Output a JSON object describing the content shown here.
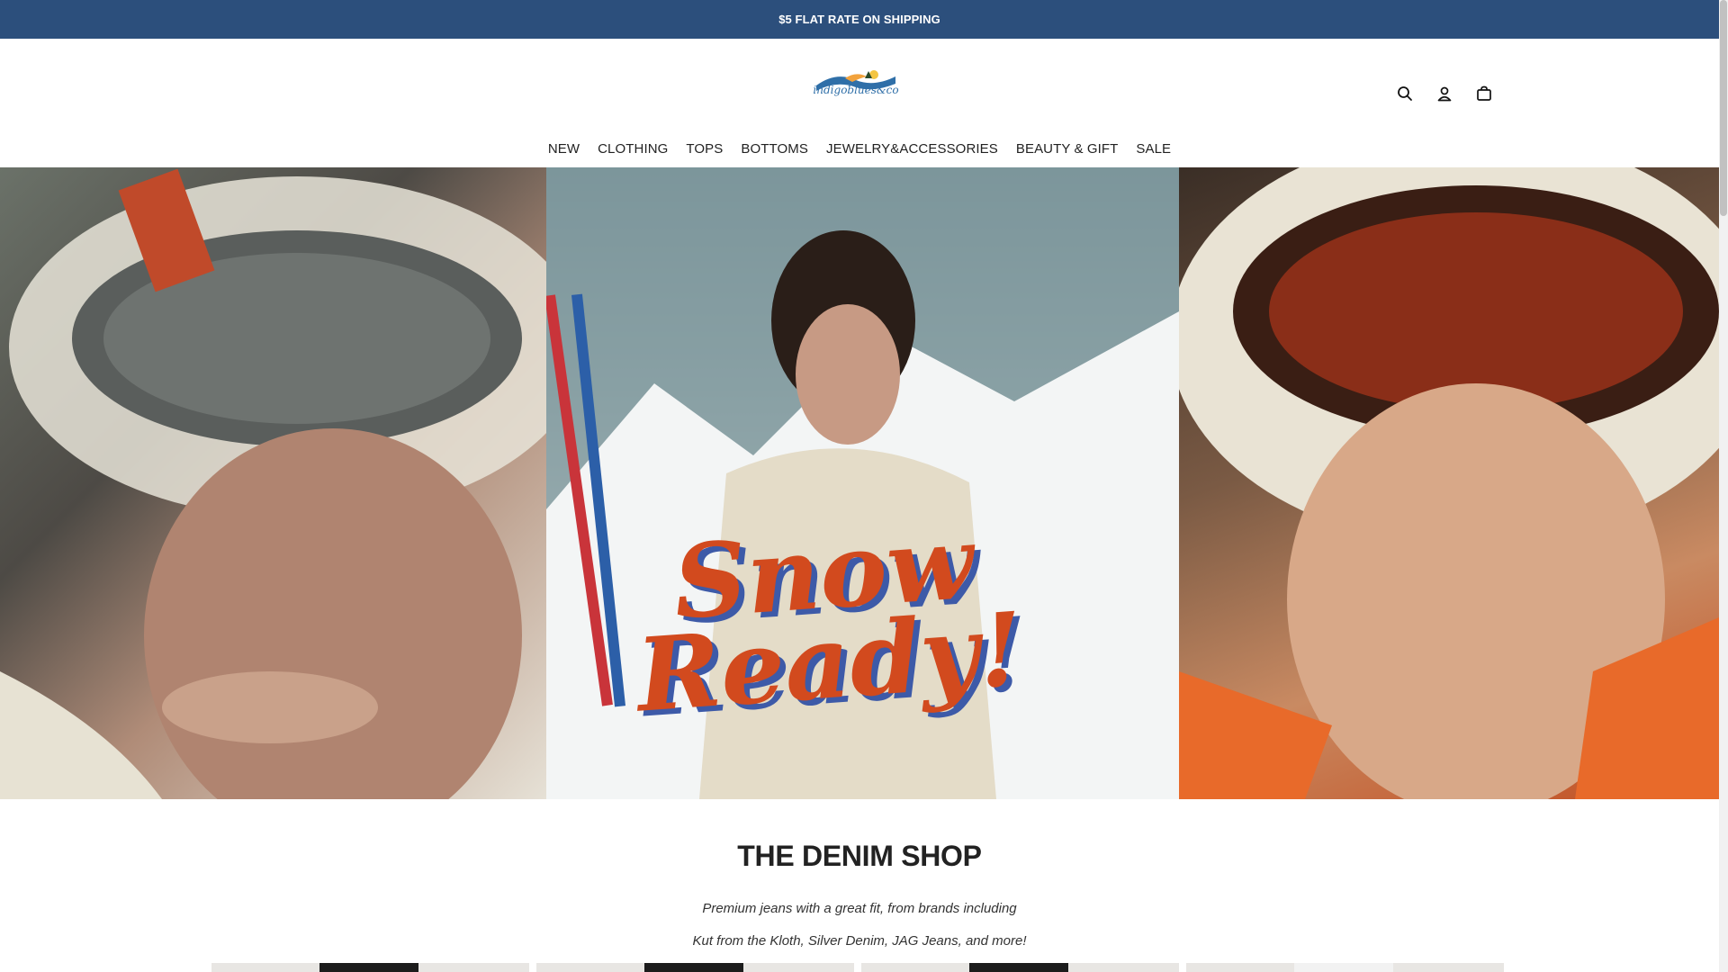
{
  "announcement": {
    "text": "$5 FLAT RATE ON SHIPPING"
  },
  "brand": {
    "logo_text": "indigoblues&co"
  },
  "header_icons": [
    "search-icon",
    "account-icon",
    "cart-icon"
  ],
  "nav": {
    "items": [
      "NEW",
      "CLOTHING",
      "TOPS",
      "BOTTOMS",
      "JEWELRY&ACCESSORIES",
      "BEAUTY & GIFT",
      "SALE"
    ]
  },
  "hero": {
    "line1": "Snow",
    "line2": "Ready!"
  },
  "denim_shop": {
    "title": "THE DENIM SHOP",
    "desc_line1": "Premium jeans with a great fit, from brands including",
    "desc_line2": "Kut from the Kloth, Silver Denim, JAG Jeans, and more!"
  },
  "colors": {
    "announcement_bg": "#2c4f7c",
    "hero_text": "#d24a1e",
    "hero_shadow": "#3d5aa8"
  }
}
